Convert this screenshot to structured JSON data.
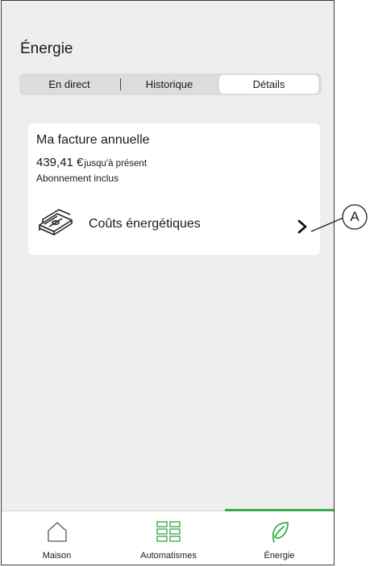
{
  "header": {
    "title": "Énergie"
  },
  "segments": [
    {
      "label": "En direct",
      "selected": false
    },
    {
      "label": "Historique",
      "selected": false
    },
    {
      "label": "Détails",
      "selected": true
    }
  ],
  "card": {
    "title": "Ma facture annuelle",
    "amount": "439,41 €",
    "amount_suffix": "jusqu'à présent",
    "subscription": "Abonnement inclus",
    "cost_link": {
      "label": "Coûts énergétiques",
      "icon": "money-stack-icon"
    }
  },
  "callout": {
    "label": "A"
  },
  "tabbar": {
    "items": [
      {
        "label": "Maison",
        "icon": "house-icon",
        "active": false
      },
      {
        "label": "Automatismes",
        "icon": "grid-icon",
        "active": false
      },
      {
        "label": "Énergie",
        "icon": "leaf-icon",
        "active": true
      }
    ]
  },
  "colors": {
    "accent": "#3dab4c",
    "background": "#eeeeee",
    "card": "#ffffff"
  }
}
